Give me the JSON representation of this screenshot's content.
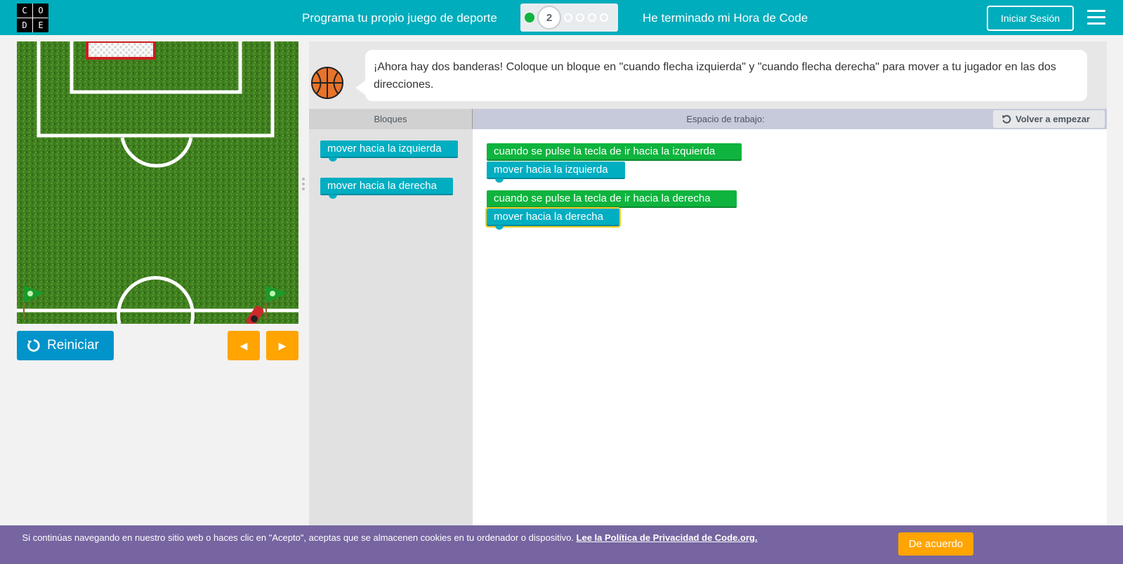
{
  "header": {
    "logo_letters": [
      "C",
      "O",
      "D",
      "E"
    ],
    "title": "Programa tu propio juego de deporte",
    "progress_current": "2",
    "finish_label": "He terminado mi Hora de Code",
    "signin_label": "Iniciar Sesión"
  },
  "game": {
    "reset_label": "Reiniciar"
  },
  "instructions": {
    "text": "¡Ahora hay dos banderas! Coloque un bloque en \"cuando flecha izquierda\" y \"cuando flecha derecha\" para mover a tu jugador en las dos direcciones."
  },
  "workspace": {
    "toolbox_header": "Bloques",
    "workspace_header": "Espacio de trabajo:",
    "restart_label": "Volver a empezar",
    "toolbox_blocks": [
      "mover hacia la izquierda",
      "mover hacia la derecha"
    ],
    "left_event": "cuando se pulse la tecla de ir hacia la izquierda",
    "left_action": "mover hacia la izquierda",
    "right_event": "cuando se pulse la tecla de ir hacia la derecha",
    "right_action": "mover hacia la derecha"
  },
  "cookie": {
    "text": "Si continúas navegando en nuestro sitio web o haces clic en \"Acepto\", aceptas que se almacenen cookies en tu ordenador o dispositivo.",
    "link": "Lee la Política de Privacidad de Code.org.",
    "accept_label": "De acuerdo"
  },
  "colors": {
    "header": "#00adbc",
    "event_block": "#0eb43d",
    "action_block": "#00aec2",
    "arrow_button": "#ffa400",
    "cookie_bar": "#7665a0"
  }
}
